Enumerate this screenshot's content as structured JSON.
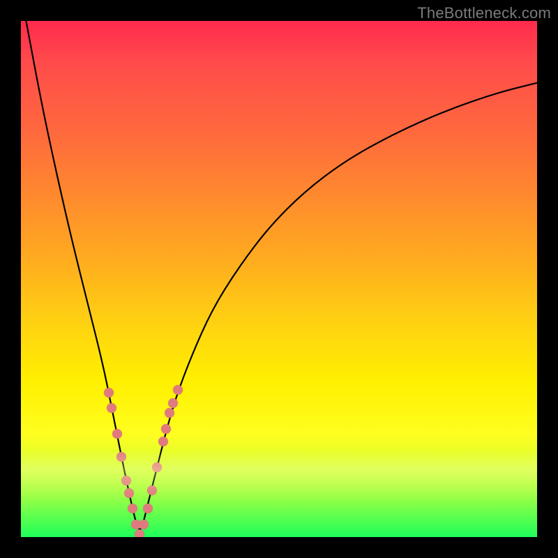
{
  "watermark": "TheBottleneck.com",
  "colors": {
    "frame": "#000000",
    "curve": "#000000",
    "marker": "#e17a7f",
    "gradient_stops": [
      "#ff2a4d",
      "#ff4b4b",
      "#ff6a3d",
      "#ff8a2e",
      "#ffab1f",
      "#ffd012",
      "#fff000",
      "#fffe20",
      "#d9ff2e",
      "#9cff44",
      "#1eff5a"
    ]
  },
  "chart_data": {
    "type": "line",
    "title": "",
    "xlabel": "",
    "ylabel": "",
    "xlim": [
      0,
      100
    ],
    "ylim": [
      0,
      100
    ],
    "x_min_point": 23,
    "series": [
      {
        "name": "curve",
        "x": [
          1,
          4,
          7,
          10,
          13,
          16,
          18,
          20,
          21.5,
          23,
          24.5,
          26,
          28,
          30,
          33,
          37,
          42,
          48,
          55,
          63,
          72,
          82,
          92,
          100
        ],
        "y": [
          100,
          84,
          70,
          57,
          45,
          33,
          23,
          13,
          6,
          0,
          6,
          12,
          20,
          27,
          35,
          44,
          52,
          60,
          67,
          73,
          78,
          82.5,
          86,
          88
        ]
      }
    ],
    "markers": {
      "name": "highlighted-points",
      "x": [
        17.0,
        17.5,
        18.6,
        19.5,
        20.4,
        20.9,
        21.6,
        22.3,
        23.0,
        23.8,
        24.6,
        25.4,
        26.4,
        27.5,
        28.1,
        28.8,
        29.5,
        30.4
      ],
      "y": [
        28.0,
        25.0,
        20.0,
        15.5,
        11.0,
        8.5,
        5.5,
        2.5,
        0.5,
        2.5,
        5.5,
        9.0,
        13.5,
        18.5,
        21.0,
        24.0,
        26.0,
        28.5
      ]
    }
  }
}
